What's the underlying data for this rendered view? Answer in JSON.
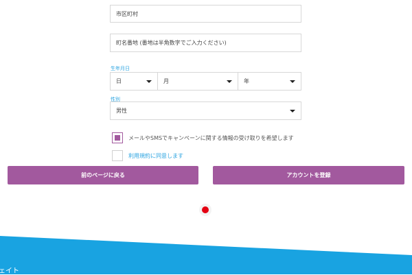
{
  "form": {
    "city_placeholder": "市区町村",
    "street_placeholder": "町名番地 (番地は半角数字でご入力ください)",
    "birthdate_label": "生年月日",
    "day_value": "日",
    "month_value": "月",
    "year_value": "年",
    "gender_label": "性別",
    "gender_value": "男性",
    "newsletter_label": "メールやSMSでキャンペーンに関する情報の受け取りを希望します",
    "terms_label": "利用規約に同意します",
    "newsletter_checked": true,
    "terms_checked": false
  },
  "buttons": {
    "back_label": "前のページに戻る",
    "register_label": "アカウントを登録"
  },
  "footer": {
    "partial_text": "ェイト"
  },
  "colors": {
    "accent": "#a2599e",
    "link": "#2aa3e0",
    "footer": "#19a3e1",
    "loader_dot": "#e40012"
  }
}
